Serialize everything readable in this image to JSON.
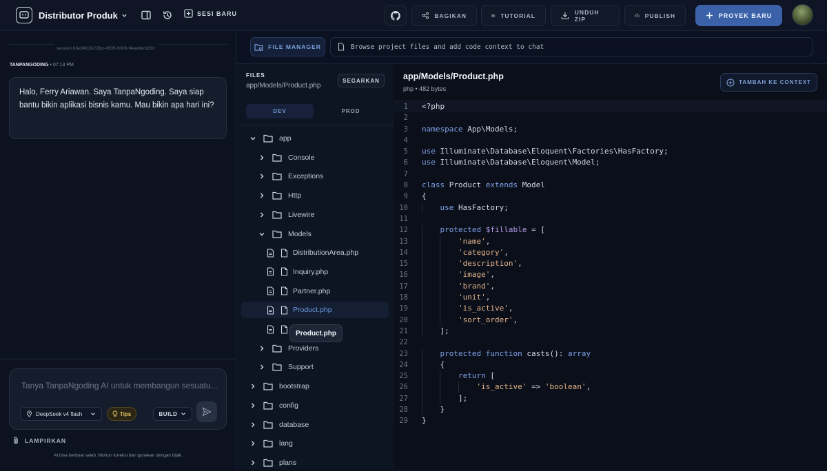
{
  "header": {
    "project_title": "Distributor Produk",
    "new_session": "SESI BARU",
    "share": "BAGIKAN",
    "tutorial": "TUTORIAL",
    "download_zip": "UNDUH ZIP",
    "publish": "PUBLISH",
    "new_project": "PROYEK BARU"
  },
  "chat": {
    "session_id": "session b3e84618-53bc-4505-9009-f4eedlec9391",
    "sender": "TANPANGODING",
    "time": "• 07:13 PM",
    "message": "Halo, Ferry Ariawan. Saya TanpaNgoding. Saya siap bantu bikin aplikasi bisnis kamu. Mau bikin apa hari ini?",
    "input_placeholder": "Tanya TanpaNgoding AI untuk membangun sesuatu...",
    "model": "DeepSeek v4 flash",
    "tips": "Tips",
    "mode": "BUILD",
    "attach": "LAMPIRKAN",
    "disclaimer": "AI bisa berbuat salah. Mohon koreksi dan gunakan dengan bijak."
  },
  "file_manager": {
    "button": "FILE MANAGER",
    "hint": "Browse project files and add code context to chat",
    "files_label": "FILES",
    "current_path": "app/Models/Product.php",
    "refresh": "SEGARKAN",
    "env_dev": "DEV",
    "env_prod": "PROD",
    "tooltip": "Product.php",
    "tree": [
      {
        "label": "app",
        "type": "folder",
        "expanded": true
      },
      {
        "label": "Console",
        "type": "folder",
        "expanded": false
      },
      {
        "label": "Exceptions",
        "type": "folder",
        "expanded": false
      },
      {
        "label": "Http",
        "type": "folder",
        "expanded": false
      },
      {
        "label": "Livewire",
        "type": "folder",
        "expanded": false
      },
      {
        "label": "Models",
        "type": "folder",
        "expanded": true
      },
      {
        "label": "DistributionArea.php",
        "type": "file"
      },
      {
        "label": "Inquiry.php",
        "type": "file"
      },
      {
        "label": "Partner.php",
        "type": "file"
      },
      {
        "label": "Product.php",
        "type": "file",
        "selected": true
      },
      {
        "label": "",
        "type": "file"
      },
      {
        "label": "Providers",
        "type": "folder",
        "expanded": false
      },
      {
        "label": "Support",
        "type": "folder",
        "expanded": false
      },
      {
        "label": "bootstrap",
        "type": "folder",
        "expanded": false
      },
      {
        "label": "config",
        "type": "folder",
        "expanded": false
      },
      {
        "label": "database",
        "type": "folder",
        "expanded": false
      },
      {
        "label": "lang",
        "type": "folder",
        "expanded": false
      },
      {
        "label": "plans",
        "type": "folder",
        "expanded": false
      }
    ]
  },
  "editor": {
    "file_title": "app/Models/Product.php",
    "meta": "php • 482 bytes",
    "add_context": "TAMBAH KE CONTEXT",
    "language": "php",
    "code_lines": [
      "<?php",
      "",
      "namespace App\\Models;",
      "",
      "use Illuminate\\Database\\Eloquent\\Factories\\HasFactory;",
      "use Illuminate\\Database\\Eloquent\\Model;",
      "",
      "class Product extends Model",
      "{",
      "    use HasFactory;",
      "",
      "    protected $fillable = [",
      "        'name',",
      "        'category',",
      "        'description',",
      "        'image',",
      "        'brand',",
      "        'unit',",
      "        'is_active',",
      "        'sort_order',",
      "    ];",
      "",
      "    protected function casts(): array",
      "    {",
      "        return [",
      "            'is_active' => 'boolean',",
      "        ];",
      "    }",
      "}"
    ]
  },
  "colors": {
    "accent": "#3b62a8",
    "keyword": "#7fa0e6",
    "string": "#e3b387",
    "variable": "#b39ce8"
  }
}
